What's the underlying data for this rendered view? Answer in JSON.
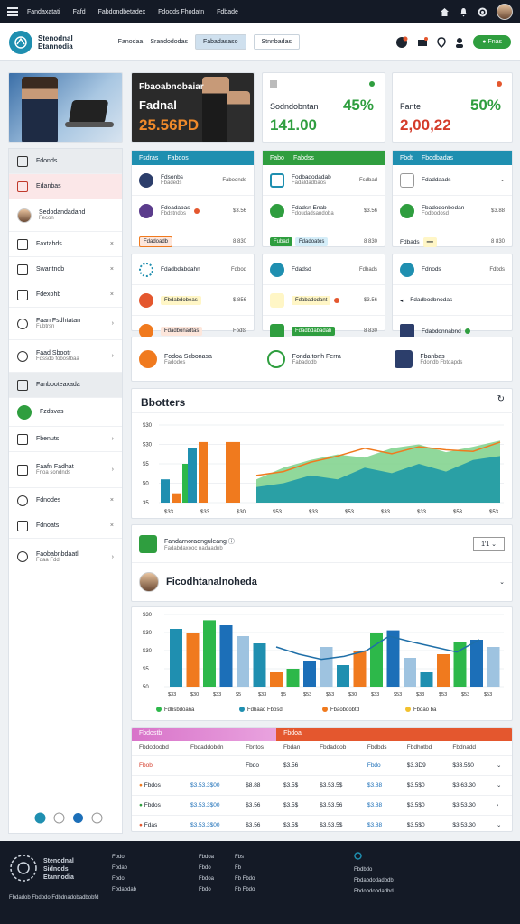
{
  "topbar": {
    "menu": [
      "Fandaxatati",
      "Fafd",
      "Fabdondbetadex",
      "Fdoods Fhodatn",
      "Fdbade"
    ]
  },
  "header": {
    "brand_line1": "Stenodnal",
    "brand_line2": "Etannodia",
    "nav": [
      "Fanodaa",
      "Srandododas",
      "Fabadasaso",
      "Stnnbadas"
    ],
    "action_label": "Fnas"
  },
  "kpis": {
    "card2_line1": "Fbaoabnobaiar",
    "card2_line2": "Fadnal",
    "card2_value": "25.56PD",
    "card3_label": "Sodndobntan",
    "card3_value": "141.00",
    "card3_pct": "45%",
    "card4_label": "Fante",
    "card4_value": "2,00,22",
    "card4_pct": "50%"
  },
  "sidebar": {
    "items": [
      {
        "label": "Fdonds",
        "sub": ""
      },
      {
        "label": "Edanbas",
        "sub": ""
      },
      {
        "label": "Sedodandadahd",
        "sub": "Fecon"
      },
      {
        "label": "Faxtahds",
        "sub": ""
      },
      {
        "label": "Swantnob",
        "sub": ""
      },
      {
        "label": "Fdexohb",
        "sub": ""
      },
      {
        "label": "Faan Fsdhtatan",
        "sub": "Fubtrsn"
      },
      {
        "label": "Faad Sbootr",
        "sub": "Fdssdo fobostbaa"
      },
      {
        "label": "Fanbooteaxada",
        "sub": ""
      },
      {
        "label": "Fzdavas",
        "sub": ""
      },
      {
        "label": "Fbenuts",
        "sub": ""
      },
      {
        "label": "Faafn Fadhat",
        "sub": "Fnoa sondnds"
      },
      {
        "label": "Fdnodes",
        "sub": ""
      },
      {
        "label": "Fdnoats",
        "sub": ""
      },
      {
        "label": "Faobabnbdaatl",
        "sub": "Fdaa Fdd"
      }
    ]
  },
  "tiles": {
    "t1": {
      "head": [
        "Fsdras",
        "Fabdos"
      ],
      "rows": [
        {
          "label": "Fdsonbs",
          "sub": "Fbadeds",
          "val": "Fabodnds"
        },
        {
          "label": "Fdeadabas",
          "sub": "Fbdstndos",
          "val": "$3.56"
        },
        {
          "label": "Fdadoadb",
          "sub": "",
          "val": "8 830"
        }
      ]
    },
    "t2": {
      "head": [
        "Fabo",
        "Fabdss"
      ],
      "rows": [
        {
          "label": "Fodbadodadab",
          "sub": "Fadaldadbaos",
          "val": "Fsdbad"
        },
        {
          "label": "Fdadsn Enab",
          "sub": "Fdoudadsandoba",
          "val": "$3.56"
        },
        {
          "label": "Fubad",
          "sub": "Fdadoatos",
          "val": "8 830"
        }
      ]
    },
    "t3": {
      "head": [
        "Fbdt",
        "Fbodbadas"
      ],
      "rows": [
        {
          "label": "Fdaddaads",
          "sub": "",
          "val": ""
        },
        {
          "label": "Fbadodonbedan",
          "sub": "Fodbodosd",
          "val": "$3.88"
        },
        {
          "label": "Fdbads",
          "sub": "",
          "val": "8 830"
        }
      ]
    },
    "t4": {
      "rows": [
        {
          "label": "Fdadbdabdahn",
          "val": "Fdbod"
        },
        {
          "label": "Fbdabdobeas",
          "val": "$.856"
        },
        {
          "label": "Fdadbonadtas",
          "val": "Fbdts"
        }
      ]
    },
    "t5": {
      "rows": [
        {
          "label": "Fdadsd",
          "val": "Fdbads"
        },
        {
          "label": "Fdabadodant",
          "val": "$3.56"
        },
        {
          "label": "Fdadbdabadah",
          "val": "8 830"
        }
      ]
    },
    "t6": {
      "rows": [
        {
          "label": "Fdnods",
          "val": "Fdbds"
        },
        {
          "label": "Fdadbodbnodas",
          "val": ""
        },
        {
          "label": "Fdabdonnabnd",
          "val": ""
        }
      ]
    }
  },
  "quick": [
    {
      "label": "Fodoa Scbonasa",
      "sub": "Fadodes"
    },
    {
      "label": "Fonda tonh Ferra",
      "sub": "Fabadodb"
    },
    {
      "label": "Fbanbas",
      "sub": "Fdondb Fbtdapds"
    }
  ],
  "chart1_title": "Bbotters",
  "panel": {
    "title": "Fandarnoradnguleang",
    "sub": "Fadabdaxooc nadaadnb",
    "select": "1'1",
    "person_title": "Ficodhtanalnoheda"
  },
  "chart_data": [
    {
      "type": "bar",
      "title": "Bbotters",
      "yticks": [
        "$30",
        "$30",
        "$5",
        "50",
        "35"
      ],
      "xticks": [
        "$33",
        "$33",
        "$30",
        "$53",
        "$33",
        "$53",
        "$33",
        "$33",
        "$53",
        "$53"
      ],
      "series": [
        {
          "color": "#1f8fb0",
          "values": [
            30,
            70
          ]
        },
        {
          "color": "#f07a1e",
          "values": [
            12,
            78
          ]
        },
        {
          "color": "#2db84a",
          "values": [
            50,
            0
          ]
        }
      ],
      "area": {
        "green": [
          30,
          45,
          55,
          62,
          58,
          70,
          75,
          65,
          72,
          80
        ],
        "teal": [
          20,
          25,
          35,
          30,
          45,
          38,
          50,
          40,
          55,
          60
        ],
        "line": [
          35,
          40,
          52,
          60,
          70,
          63,
          72,
          68,
          66,
          78
        ]
      }
    },
    {
      "type": "bar",
      "yticks": [
        "$30",
        "$30",
        "$30",
        "$5",
        "50"
      ],
      "xticks": [
        "$33",
        "$30",
        "$33",
        "$5",
        "$33",
        "$5",
        "$53",
        "$53",
        "$30",
        "$33",
        "$53",
        "$33",
        "$53",
        "$53",
        "$53"
      ],
      "legend": [
        "Fdbsbdoana",
        "Fdbaad Fbbsd",
        "Fbaobdobtd",
        "Fbdao ba"
      ],
      "line": [
        55,
        45,
        38,
        42,
        50,
        70,
        62,
        55,
        48,
        65
      ]
    }
  ],
  "table": {
    "tabs": [
      "Fbdostb",
      "Fbdoa"
    ],
    "headers": [
      "Fbdodoobd",
      "Fbdaddobdn",
      "Fbntos",
      "Fbdan",
      "Fbdadoob",
      "Fbdbds",
      "Fbdhotbd",
      "Fbdnadd"
    ],
    "rows": [
      [
        "Fbob",
        "",
        "Fbdo",
        "$3.56",
        "",
        "Fbdo",
        "$3.3D9",
        "$33.5$0"
      ],
      [
        "Fbdos",
        "$3.53.3$00",
        "$8.88",
        "$3.5$",
        "$3.53.5$",
        "$3.88",
        "$3.5$0",
        "$3.63.30"
      ],
      [
        "Fbdos",
        "$3.53.3$00",
        "$3.56",
        "$3.5$",
        "$3.53.56",
        "$3.88",
        "$3.5$0",
        "$3.53.30"
      ],
      [
        "Fdas",
        "$3.53.3$00",
        "$3.56",
        "$3.5$",
        "$3.53.5$",
        "$3.88",
        "$3.5$0",
        "$3.53.30"
      ]
    ]
  },
  "footer": {
    "brand": [
      "Stenodnal",
      "Sidnods",
      "Etannodia"
    ],
    "copyright": "Fbdadob Fbdodo Fdbdnadobadbobfd",
    "col1": [
      "Fbdo",
      "Fbdab",
      "Fbdo",
      "Fbdabdab"
    ],
    "col2": [
      "Fbdoa",
      "Fbdo",
      "Fbdoa",
      "Fbdo"
    ],
    "col3": [
      "Fbs",
      "Fb",
      "Fb Fbdo",
      "Fb Fbdo"
    ],
    "col4": [
      "Fbdbdo",
      "Fbdabdodadbdb",
      "Fbdobdobdadbd"
    ]
  }
}
